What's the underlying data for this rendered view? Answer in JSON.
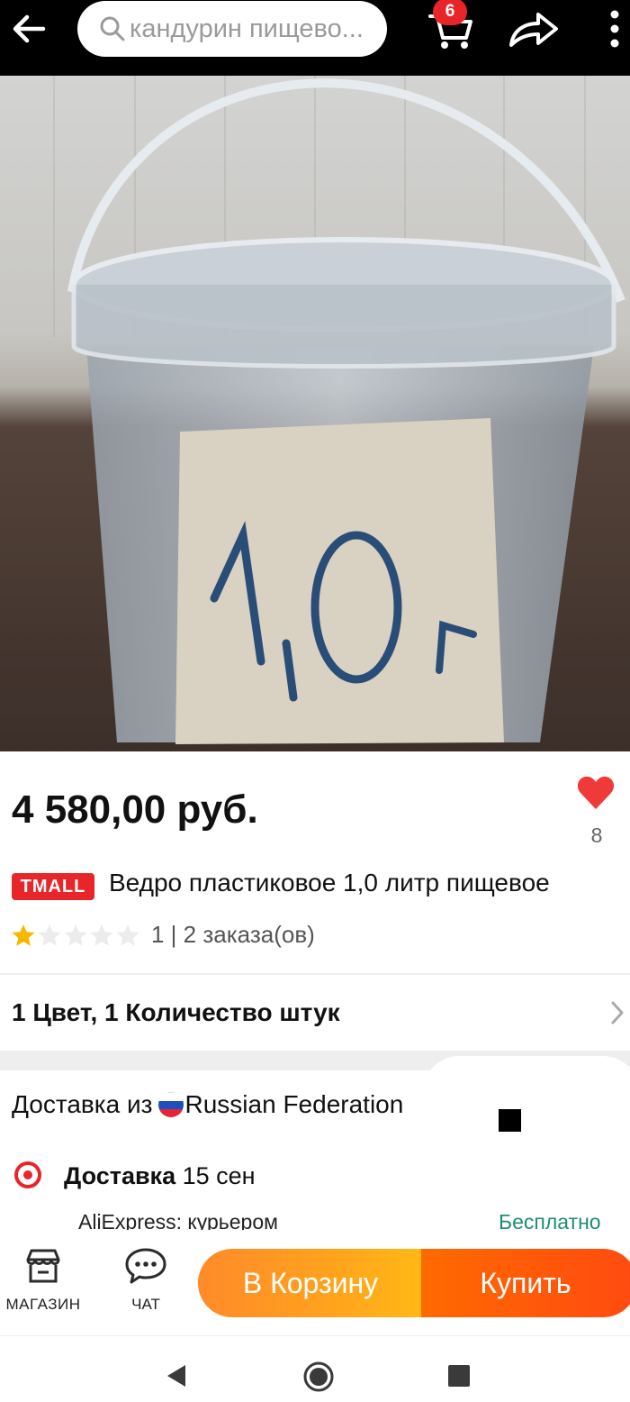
{
  "topbar": {
    "search_placeholder": "кандурин пищево...",
    "cart_count": "6"
  },
  "product": {
    "image_label": "1,0 г",
    "price": "4 580,00 руб.",
    "favorites_count": "8",
    "store_badge": "TMALL",
    "title": "Ведро пластиковое 1,0 литр пищевое",
    "rating": 1,
    "rating_max": 5,
    "rating_text": "1 | 2 заказа(ов)",
    "variant": "1 Цвет, 1 Количество штук"
  },
  "delivery": {
    "from_label": "Доставка из",
    "country": "Russian Federation",
    "label": "Доставка",
    "date": "15 сен",
    "carrier": "AliExpress: курьером",
    "price": "Бесплатно"
  },
  "actions": {
    "shop_label": "МАГАЗИН",
    "chat_label": "ЧАТ",
    "cart_button": "В Корзину",
    "buy_button": "Купить"
  },
  "colors": {
    "accent_red": "#e8262a",
    "cart_orange": "#ffa31d",
    "buy_orange": "#ff5a0a",
    "free_green": "#1f8f6a"
  },
  "icons": [
    "back-arrow-icon",
    "search-icon",
    "cart-icon",
    "share-icon",
    "more-icon",
    "heart-icon",
    "star-icon",
    "chevron-right-icon",
    "russia-flag-icon",
    "store-icon",
    "chat-icon"
  ]
}
